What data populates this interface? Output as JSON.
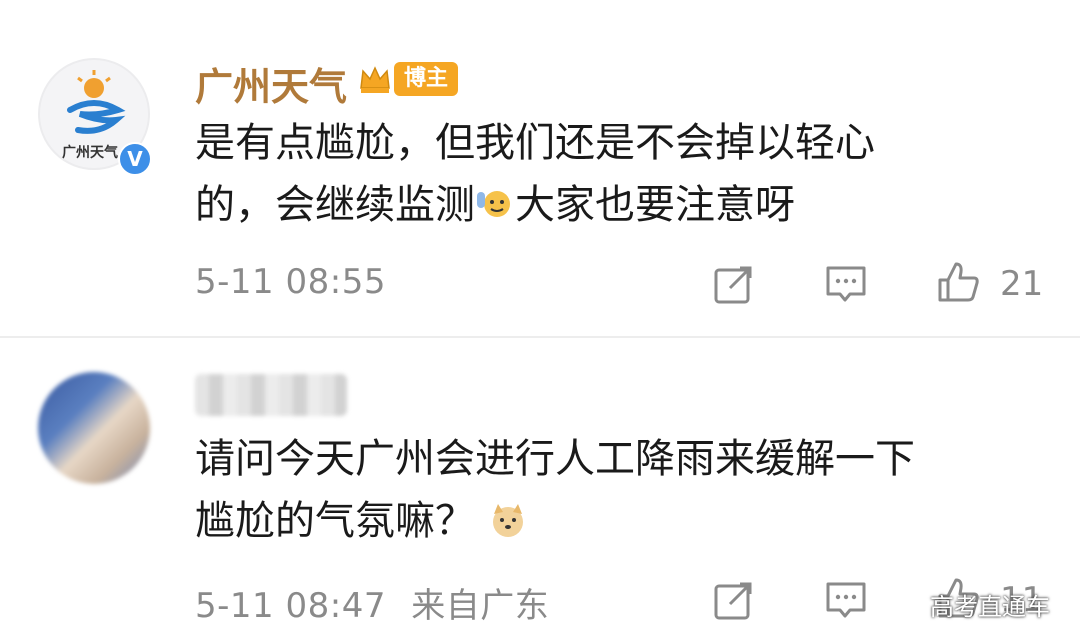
{
  "comments": [
    {
      "username": "广州天气",
      "badge": "博主",
      "avatar_text": "广州天气",
      "verified_mark": "V",
      "content_line1": "是有点尴尬，但我们还是不会掉以轻心",
      "content_line2a": "的，会继续监测",
      "content_line2b": "大家也要注意呀",
      "emoji": "waving-emoji",
      "timestamp": "5-11 08:55",
      "likes": "21"
    },
    {
      "username": "",
      "content_line1": "请问今天广州会进行人工降雨来缓解一下",
      "content_line2": "尴尬的气氛嘛？",
      "emoji": "doge-emoji",
      "timestamp": "5-11 08:47",
      "location": "来自广东",
      "likes": "11"
    }
  ],
  "watermark": "高考直通车",
  "colors": {
    "username_brand": "#b07a3a",
    "badge": "#f5a623",
    "meta_gray": "#8a8a8a",
    "verified_blue": "#3d8fe8"
  }
}
